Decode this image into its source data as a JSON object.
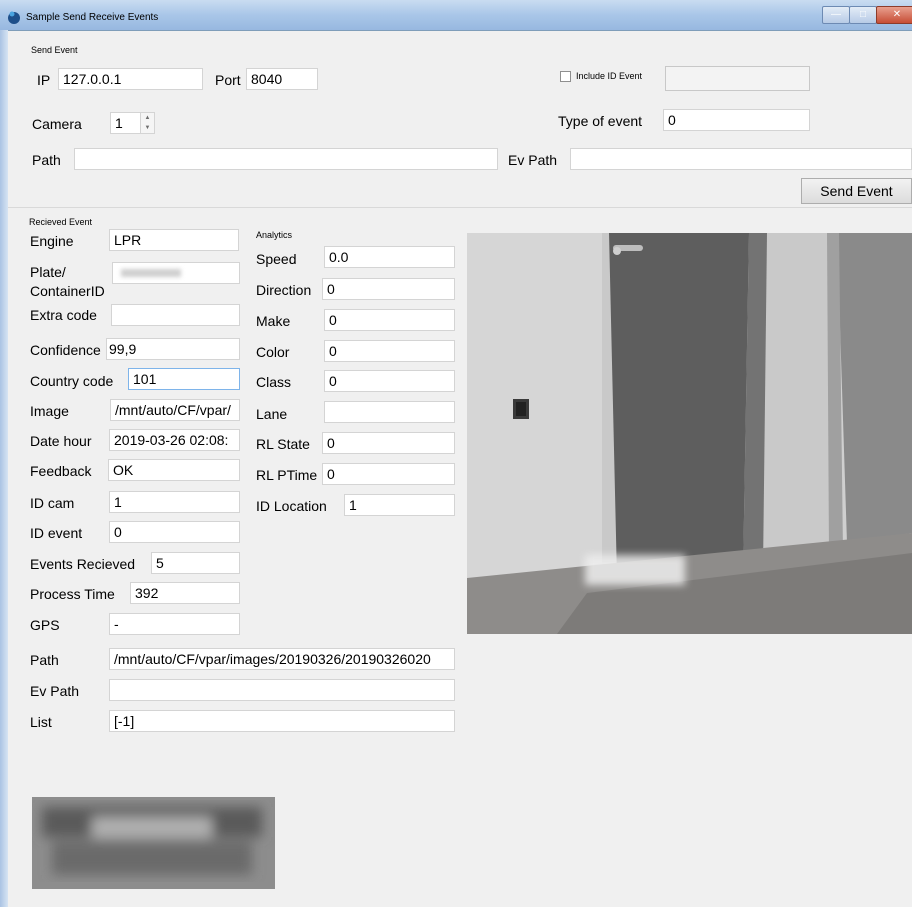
{
  "window": {
    "title": "Sample Send Receive Events"
  },
  "send_event": {
    "group_label": "Send Event",
    "ip_label": "IP",
    "ip_value": "127.0.0.1",
    "port_label": "Port",
    "port_value": "8040",
    "include_id_label": "Include ID Event",
    "include_id_value": "",
    "camera_label": "Camera",
    "camera_value": "1",
    "type_label": "Type of event",
    "type_value": "0",
    "path_label": "Path",
    "path_value": "",
    "ev_path_label": "Ev Path",
    "ev_path_value": "",
    "send_button": "Send Event"
  },
  "received_event": {
    "group_label": "Recieved Event",
    "engine_label": "Engine",
    "engine_value": "LPR",
    "plate_label_1": "Plate/",
    "plate_label_2": "ContainerID",
    "extra_label": "Extra code",
    "extra_value": "",
    "confidence_label": "Confidence",
    "confidence_value": "99,9",
    "country_label": "Country code",
    "country_value": "101",
    "image_label": "Image",
    "image_value": "/mnt/auto/CF/vpar/",
    "date_label": "Date hour",
    "date_value": "2019-03-26 02:08:",
    "feedback_label": "Feedback",
    "feedback_value": "OK",
    "idcam_label": "ID cam",
    "idcam_value": "1",
    "idevent_label": "ID event",
    "idevent_value": "0",
    "events_label": "Events Recieved",
    "events_value": "5",
    "process_label": "Process Time",
    "process_value": "392",
    "gps_label": "GPS",
    "gps_value": "-",
    "path_label": "Path",
    "path_value": "/mnt/auto/CF/vpar/images/20190326/20190326020",
    "ev_path_label": "Ev Path",
    "ev_path_value": "",
    "list_label": "List",
    "list_value": "[-1]"
  },
  "analytics": {
    "group_label": "Analytics",
    "speed_label": "Speed",
    "speed_value": "0.0",
    "direction_label": "Direction",
    "direction_value": "0",
    "make_label": "Make",
    "make_value": "0",
    "color_label": "Color",
    "color_value": "0",
    "class_label": "Class",
    "class_value": "0",
    "lane_label": "Lane",
    "lane_value": "",
    "rlstate_label": "RL State",
    "rlstate_value": "0",
    "rlptime_label": "RL PTime",
    "rlptime_value": "0",
    "idloc_label": "ID Location",
    "idloc_value": "1"
  },
  "colors": {
    "titlebar": "#a9c6e8",
    "window_bg": "#f0f0f0",
    "focus_border": "#7eb4ea"
  }
}
